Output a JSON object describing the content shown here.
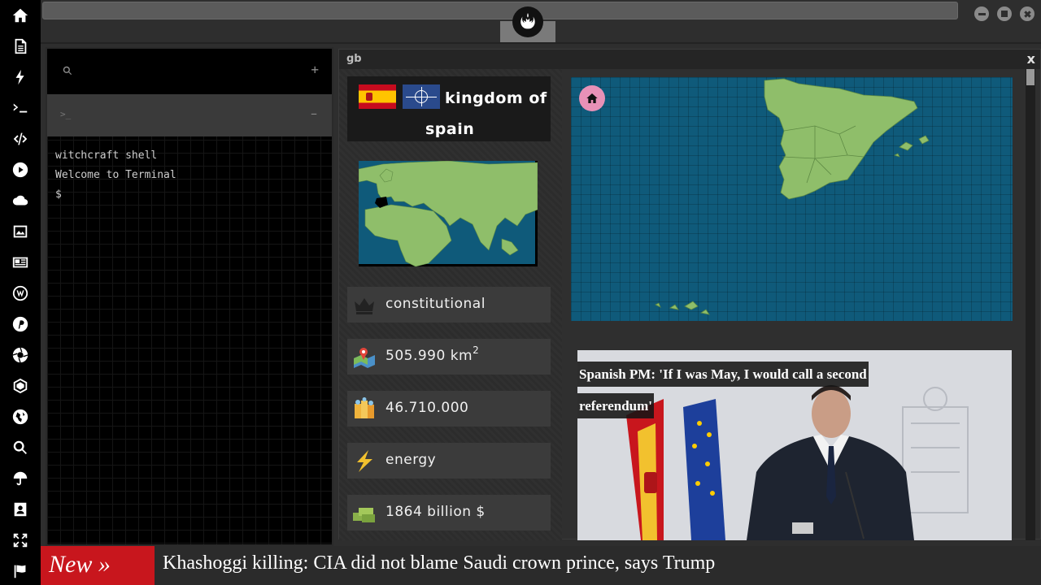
{
  "dock": {
    "items": [
      "flag-icon",
      "document-icon",
      "bolt-icon",
      "terminal-icon",
      "code-icon",
      "play-icon",
      "cloud-icon",
      "image-icon",
      "newspaper-icon",
      "wordpress-icon",
      "pinterest-icon",
      "aperture-icon",
      "network-icon",
      "globe-icon",
      "search-icon",
      "umbrella-icon",
      "contact-icon",
      "expand-icon",
      "flag-icon"
    ]
  },
  "terminal": {
    "search_placeholder": "",
    "plus_label": "+",
    "prompt_symbol": ">_",
    "minus_label": "–",
    "lines": [
      "witchcraft shell",
      "Welcome to Terminal",
      "$"
    ]
  },
  "panel": {
    "tag": "gb",
    "close_label": "x",
    "country": {
      "name_line1": "kingdom of",
      "name_line2": "spain"
    },
    "stats": [
      {
        "icon": "crown-icon",
        "value": "constitutional"
      },
      {
        "icon": "area-map-icon",
        "value": "505.990 km",
        "sup": "2"
      },
      {
        "icon": "population-icon",
        "value": "46.710.000"
      },
      {
        "icon": "energy-icon",
        "value": "energy"
      },
      {
        "icon": "money-icon",
        "value": "1864 billion $"
      }
    ],
    "news": {
      "title": "Spanish PM: 'If I was May, I would call a second referendum'"
    }
  },
  "ticker": {
    "label": "New »",
    "headline": "Khashoggi killing: CIA did not blame Saudi crown prince, says Trump"
  },
  "colors": {
    "accent_red": "#c8161d",
    "map_sea": "#0f5a7a",
    "map_land": "#8fbe6a",
    "home_button": "#e891b7"
  }
}
